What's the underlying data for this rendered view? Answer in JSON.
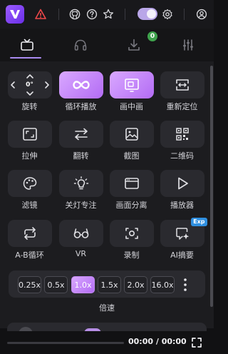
{
  "topbar": {
    "icons": [
      "logo-icon",
      "warning-icon",
      "github-icon",
      "help-icon",
      "star-icon",
      "theme-toggle",
      "settings-icon",
      "user-icon"
    ]
  },
  "tabs": {
    "items": [
      "tv-icon",
      "headphones-icon",
      "download-icon",
      "equalizer-icon"
    ],
    "download_badge": "0"
  },
  "tools": [
    {
      "label": "旋转",
      "icon": "rotate-icon",
      "value": "0°"
    },
    {
      "label": "循环播放",
      "icon": "loop-icon",
      "active": true
    },
    {
      "label": "画中画",
      "icon": "pip-icon",
      "active": true
    },
    {
      "label": "重新定位",
      "icon": "reposition-icon"
    },
    {
      "label": "拉伸",
      "icon": "stretch-icon"
    },
    {
      "label": "翻转",
      "icon": "flip-icon"
    },
    {
      "label": "截图",
      "icon": "screenshot-icon"
    },
    {
      "label": "二维码",
      "icon": "qrcode-icon"
    },
    {
      "label": "滤镜",
      "icon": "palette-icon"
    },
    {
      "label": "关灯专注",
      "icon": "bulb-icon"
    },
    {
      "label": "画面分离",
      "icon": "window-icon"
    },
    {
      "label": "播放器",
      "icon": "play-icon"
    },
    {
      "label": "A-B循环",
      "icon": "ab-loop-icon"
    },
    {
      "label": "VR",
      "icon": "vr-glasses-icon"
    },
    {
      "label": "录制",
      "icon": "record-icon"
    },
    {
      "label": "AI摘要",
      "icon": "ai-summary-icon",
      "badge": "Exp"
    }
  ],
  "speed": {
    "options": [
      "0.25x",
      "0.5x",
      "1.0x",
      "1.5x",
      "2.0x",
      "16.0x"
    ],
    "selected": "1.0x",
    "label": "倍速"
  },
  "player": {
    "time": "00:00 / 00:00",
    "progress": 0
  }
}
